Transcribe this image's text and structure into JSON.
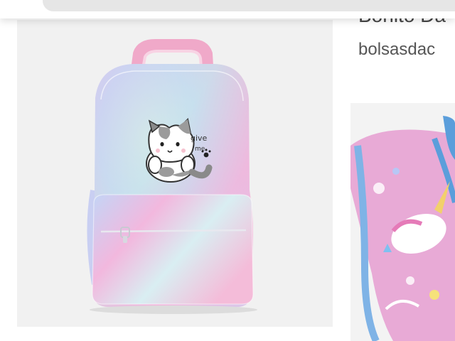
{
  "results": [
    {
      "image": "pastel tie-dye backpack with cat illustration",
      "image_text": [
        "give",
        "me"
      ],
      "colors": {
        "card_bg": "#f1f1f1",
        "bag_pink": "#f1b6d8",
        "bag_blue": "#c5daf5"
      }
    },
    {
      "title": "Bonito Da",
      "source": "bolsasdac"
    },
    {
      "image": "pink unicorn print backpack (partially visible)",
      "colors": {
        "card_bg": "#f3f3f3",
        "bag_pink": "#e8a9d7",
        "strap_blue": "#5a9bd8"
      }
    }
  ]
}
